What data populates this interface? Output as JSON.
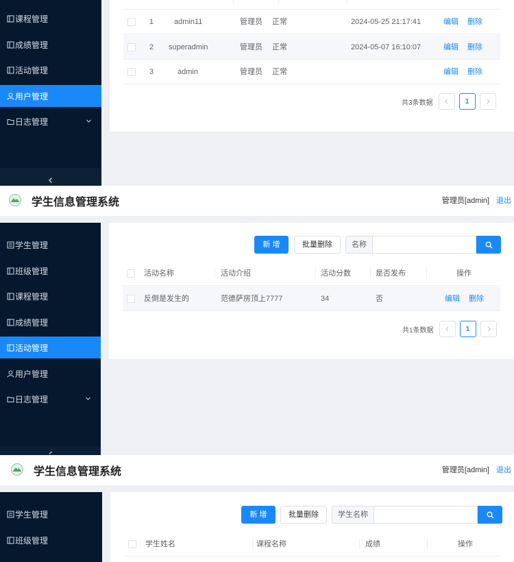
{
  "app": {
    "title": "学生信息管理系统",
    "user": "管理员[admin]",
    "logout": "退出"
  },
  "colors": {
    "sidebar": "#05182d",
    "accent": "#1989fa",
    "background": "#eef0f3"
  },
  "s1": {
    "nav": [
      {
        "label": "课程管理",
        "icon": "book-icon"
      },
      {
        "label": "成绩管理",
        "icon": "book-icon"
      },
      {
        "label": "活动管理",
        "icon": "book-icon"
      },
      {
        "label": "用户管理",
        "icon": "user-icon",
        "active": true
      },
      {
        "label": "日志管理",
        "icon": "folder-icon",
        "has_submenu": true
      }
    ],
    "table": {
      "rows": [
        {
          "index": "1",
          "name": "admin11",
          "role": "管理员",
          "status": "正常",
          "time": "2024-05-25 21:17:41",
          "edit": "编辑",
          "delete": "删除"
        },
        {
          "index": "2",
          "name": "superadmin",
          "role": "管理员",
          "status": "正常",
          "time": "2024-05-07 16:10:07",
          "edit": "编辑",
          "delete": "删除"
        },
        {
          "index": "3",
          "name": "admin",
          "role": "管理员",
          "status": "正常",
          "time": "",
          "edit": "编辑",
          "delete": "删除"
        }
      ]
    },
    "pager": {
      "total": "共3条数据",
      "page": "1"
    }
  },
  "s2": {
    "nav": [
      {
        "label": "学生管理",
        "icon": "list-icon"
      },
      {
        "label": "班级管理",
        "icon": "book-icon"
      },
      {
        "label": "课程管理",
        "icon": "book-icon"
      },
      {
        "label": "成绩管理",
        "icon": "book-icon"
      },
      {
        "label": "活动管理",
        "icon": "book-icon",
        "active": true
      },
      {
        "label": "用户管理",
        "icon": "user-icon"
      },
      {
        "label": "日志管理",
        "icon": "folder-icon",
        "has_submenu": true
      }
    ],
    "toolbar": {
      "add": "新 增",
      "batch_delete": "批量删除",
      "search_label": "名称",
      "search_value": ""
    },
    "columns": [
      "活动名称",
      "活动介绍",
      "活动分数",
      "是否发布",
      "操作"
    ],
    "rows": [
      {
        "name": "反倒是发生的",
        "intro": "范德萨房顶上7777",
        "score": "34",
        "published": "否",
        "edit": "编辑",
        "delete": "删除"
      }
    ],
    "pager": {
      "total": "共1条数据",
      "page": "1"
    }
  },
  "s3": {
    "nav": [
      {
        "label": "学生管理",
        "icon": "list-icon"
      },
      {
        "label": "班级管理",
        "icon": "book-icon"
      }
    ],
    "toolbar": {
      "add": "新 增",
      "batch_delete": "批量删除",
      "search_label": "学生名称",
      "search_value": ""
    },
    "columns": [
      "学生姓名",
      "课程名称",
      "成绩",
      "操作"
    ]
  }
}
